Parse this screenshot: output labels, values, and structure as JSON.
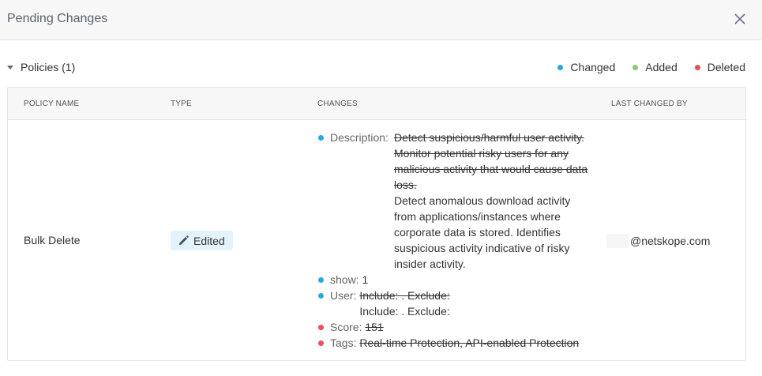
{
  "dialog": {
    "title": "Pending Changes"
  },
  "section": {
    "title": "Policies (1)"
  },
  "legend": [
    {
      "label": "Changed",
      "color": "#27a9dc"
    },
    {
      "label": "Added",
      "color": "#8bc77a"
    },
    {
      "label": "Deleted",
      "color": "#ee4d5b"
    }
  ],
  "table": {
    "headers": [
      "POLICY NAME",
      "TYPE",
      "CHANGES",
      "LAST CHANGED BY"
    ],
    "row": {
      "policy_name": "Bulk Delete",
      "type": "Edited",
      "last_changed_by": "@netskope.com",
      "changes": {
        "description": {
          "label": "Description:",
          "old": "Detect suspicious/harmful user activity. Monitor potential risky users for any malicious activity that would cause data loss.",
          "new": "Detect anomalous download activity from applications/instances where corporate data is stored. Identifies suspicious activity indicative of risky insider activity."
        },
        "show": {
          "label": "show:",
          "new": "1"
        },
        "user": {
          "label": "User:",
          "old": "Include: . Exclude:",
          "new": "Include: . Exclude:"
        },
        "score": {
          "label": "Score:",
          "old": "151"
        },
        "tags": {
          "label": "Tags:",
          "old": "Real-time Protection, API-enabled Protection"
        }
      }
    }
  }
}
